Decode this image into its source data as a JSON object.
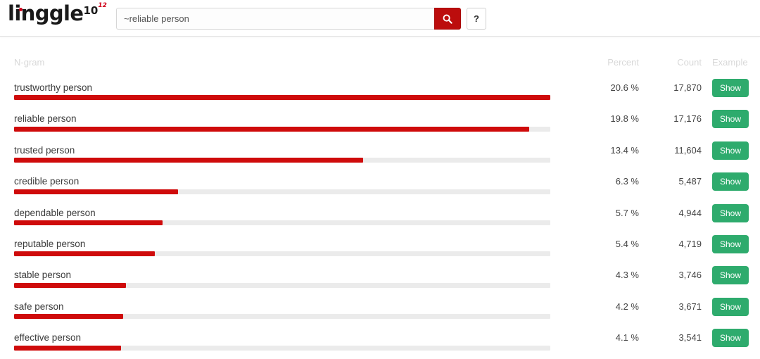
{
  "header": {
    "logo": {
      "word": "linggle",
      "sup_primary": "10",
      "sup_secondary": "12",
      "dot_color": "#d0021b"
    },
    "search": {
      "value": "~reliable person",
      "placeholder": "Search n-gram",
      "search_icon": "search-icon",
      "search_button_color": "#bc0d0d"
    },
    "help": {
      "label": "?"
    }
  },
  "table": {
    "columns": {
      "ngram": "N-gram",
      "percent": "Percent",
      "count": "Count",
      "example": "Example"
    },
    "example_button_label": "Show",
    "example_button_color": "#2eab6d",
    "bar_fill_color": "#cf0b0b",
    "bar_track_color": "#ebebeb",
    "rows": [
      {
        "ngram": "trustworthy person",
        "percent": "20.6 %",
        "percent_value": 20.6,
        "count": "17,870",
        "example_label": "Show"
      },
      {
        "ngram": "reliable person",
        "percent": "19.8 %",
        "percent_value": 19.8,
        "count": "17,176",
        "example_label": "Show"
      },
      {
        "ngram": "trusted person",
        "percent": "13.4 %",
        "percent_value": 13.4,
        "count": "11,604",
        "example_label": "Show"
      },
      {
        "ngram": "credible person",
        "percent": "6.3 %",
        "percent_value": 6.3,
        "count": "5,487",
        "example_label": "Show"
      },
      {
        "ngram": "dependable person",
        "percent": "5.7 %",
        "percent_value": 5.7,
        "count": "4,944",
        "example_label": "Show"
      },
      {
        "ngram": "reputable person",
        "percent": "5.4 %",
        "percent_value": 5.4,
        "count": "4,719",
        "example_label": "Show"
      },
      {
        "ngram": "stable person",
        "percent": "4.3 %",
        "percent_value": 4.3,
        "count": "3,746",
        "example_label": "Show"
      },
      {
        "ngram": "safe person",
        "percent": "4.2 %",
        "percent_value": 4.2,
        "count": "3,671",
        "example_label": "Show"
      },
      {
        "ngram": "effective person",
        "percent": "4.1 %",
        "percent_value": 4.1,
        "count": "3,541",
        "example_label": "Show"
      }
    ]
  },
  "chart_data": {
    "type": "bar",
    "title": "Linggle n-gram frequency for \"~reliable person\"",
    "xlabel": "Percent",
    "ylabel": "N-gram",
    "categories": [
      "trustworthy person",
      "reliable person",
      "trusted person",
      "credible person",
      "dependable person",
      "reputable person",
      "stable person",
      "safe person",
      "effective person"
    ],
    "values": [
      20.6,
      19.8,
      13.4,
      6.3,
      5.7,
      5.4,
      4.3,
      4.2,
      4.1
    ],
    "counts": [
      17870,
      17176,
      11604,
      5487,
      4944,
      4719,
      3746,
      3671,
      3541
    ],
    "unit": "%",
    "xlim": [
      0,
      20.6
    ],
    "grid": false,
    "legend": "none",
    "orientation": "horizontal"
  }
}
